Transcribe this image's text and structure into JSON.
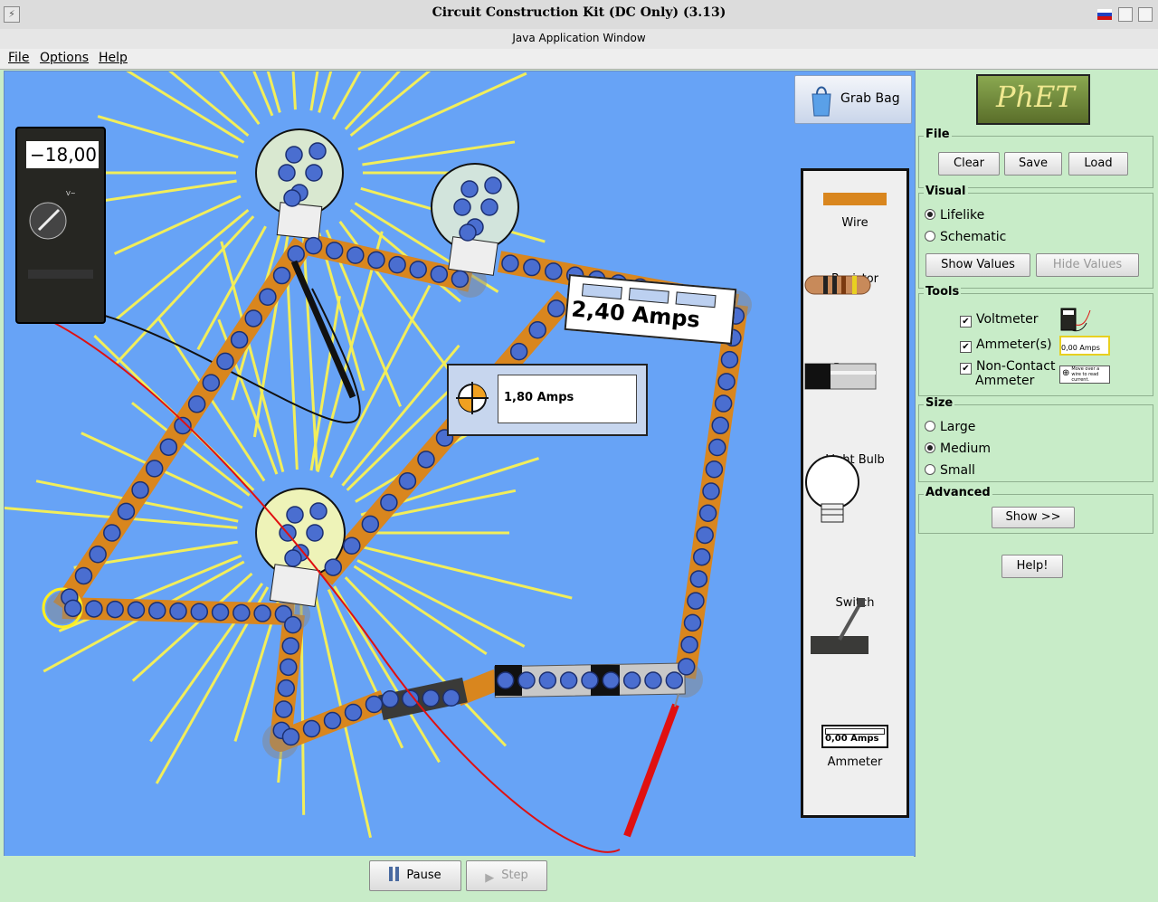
{
  "window": {
    "title": "Circuit Construction Kit (DC Only) (3.13)",
    "subtitle": "Java Application Window"
  },
  "menu": {
    "file": "File",
    "options": "Options",
    "help": "Help"
  },
  "canvas": {
    "grab_bag_label": "Grab Bag",
    "voltmeter_reading": "−18,00 V",
    "noncontact_ammeter_reading": "1,80 Amps",
    "ammeter_reading": "2,40 Amps"
  },
  "toolbox": {
    "wire": "Wire",
    "resistor": "Resistor",
    "battery": "Battery",
    "light_bulb": "Light Bulb",
    "switch": "Switch",
    "ammeter": "Ammeter",
    "ammeter_icon_text": "0,00 Amps"
  },
  "controls": {
    "pause": "Pause",
    "step": "Step"
  },
  "panel": {
    "logo": "PhET",
    "file": {
      "title": "File",
      "clear": "Clear",
      "save": "Save",
      "load": "Load"
    },
    "visual": {
      "title": "Visual",
      "lifelike": "Lifelike",
      "schematic": "Schematic",
      "selected": "Lifelike",
      "show_values": "Show Values",
      "hide_values": "Hide Values"
    },
    "tools": {
      "title": "Tools",
      "voltmeter": "Voltmeter",
      "ammeters": "Ammeter(s)",
      "noncontact_1": "Non-Contact",
      "noncontact_2": "Ammeter",
      "ammeter_icon_text": "0,00 Amps",
      "noncontact_icon_text": "Move over a wire to read current.",
      "voltmeter_checked": true,
      "ammeters_checked": true,
      "noncontact_checked": true
    },
    "size": {
      "title": "Size",
      "large": "Large",
      "medium": "Medium",
      "small": "Small",
      "selected": "Medium"
    },
    "advanced": {
      "title": "Advanced",
      "show": "Show >>"
    },
    "help": "Help!"
  },
  "colors": {
    "canvas_bg": "#67a3f6",
    "panel_bg": "#c8ecc8",
    "wire": "#d9861e",
    "electron": "#4a6ed0",
    "light_ray": "#f2ee5a",
    "probe_red": "#e01010"
  }
}
